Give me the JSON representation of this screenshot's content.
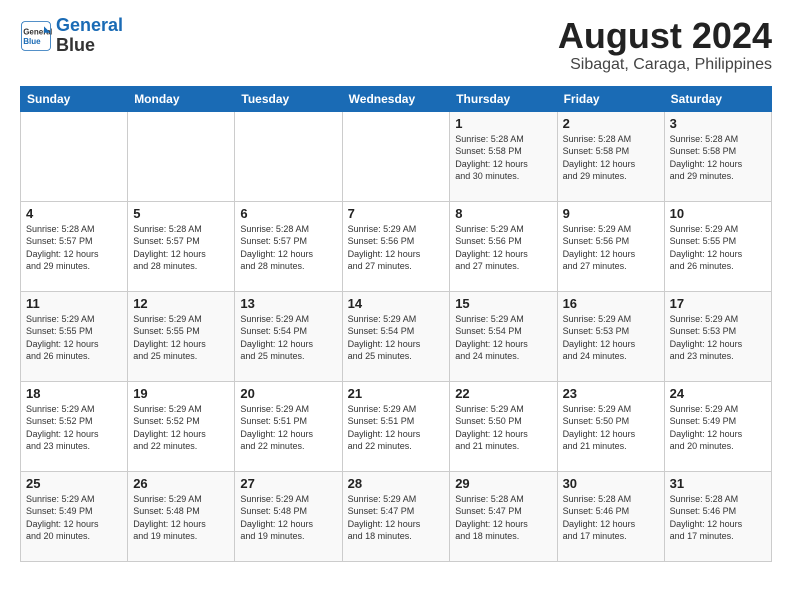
{
  "header": {
    "logo_line1": "General",
    "logo_line2": "Blue",
    "title": "August 2024",
    "subtitle": "Sibagat, Caraga, Philippines"
  },
  "columns": [
    "Sunday",
    "Monday",
    "Tuesday",
    "Wednesday",
    "Thursday",
    "Friday",
    "Saturday"
  ],
  "rows": [
    [
      {
        "num": "",
        "info": ""
      },
      {
        "num": "",
        "info": ""
      },
      {
        "num": "",
        "info": ""
      },
      {
        "num": "",
        "info": ""
      },
      {
        "num": "1",
        "info": "Sunrise: 5:28 AM\nSunset: 5:58 PM\nDaylight: 12 hours\nand 30 minutes."
      },
      {
        "num": "2",
        "info": "Sunrise: 5:28 AM\nSunset: 5:58 PM\nDaylight: 12 hours\nand 29 minutes."
      },
      {
        "num": "3",
        "info": "Sunrise: 5:28 AM\nSunset: 5:58 PM\nDaylight: 12 hours\nand 29 minutes."
      }
    ],
    [
      {
        "num": "4",
        "info": "Sunrise: 5:28 AM\nSunset: 5:57 PM\nDaylight: 12 hours\nand 29 minutes."
      },
      {
        "num": "5",
        "info": "Sunrise: 5:28 AM\nSunset: 5:57 PM\nDaylight: 12 hours\nand 28 minutes."
      },
      {
        "num": "6",
        "info": "Sunrise: 5:28 AM\nSunset: 5:57 PM\nDaylight: 12 hours\nand 28 minutes."
      },
      {
        "num": "7",
        "info": "Sunrise: 5:29 AM\nSunset: 5:56 PM\nDaylight: 12 hours\nand 27 minutes."
      },
      {
        "num": "8",
        "info": "Sunrise: 5:29 AM\nSunset: 5:56 PM\nDaylight: 12 hours\nand 27 minutes."
      },
      {
        "num": "9",
        "info": "Sunrise: 5:29 AM\nSunset: 5:56 PM\nDaylight: 12 hours\nand 27 minutes."
      },
      {
        "num": "10",
        "info": "Sunrise: 5:29 AM\nSunset: 5:55 PM\nDaylight: 12 hours\nand 26 minutes."
      }
    ],
    [
      {
        "num": "11",
        "info": "Sunrise: 5:29 AM\nSunset: 5:55 PM\nDaylight: 12 hours\nand 26 minutes."
      },
      {
        "num": "12",
        "info": "Sunrise: 5:29 AM\nSunset: 5:55 PM\nDaylight: 12 hours\nand 25 minutes."
      },
      {
        "num": "13",
        "info": "Sunrise: 5:29 AM\nSunset: 5:54 PM\nDaylight: 12 hours\nand 25 minutes."
      },
      {
        "num": "14",
        "info": "Sunrise: 5:29 AM\nSunset: 5:54 PM\nDaylight: 12 hours\nand 25 minutes."
      },
      {
        "num": "15",
        "info": "Sunrise: 5:29 AM\nSunset: 5:54 PM\nDaylight: 12 hours\nand 24 minutes."
      },
      {
        "num": "16",
        "info": "Sunrise: 5:29 AM\nSunset: 5:53 PM\nDaylight: 12 hours\nand 24 minutes."
      },
      {
        "num": "17",
        "info": "Sunrise: 5:29 AM\nSunset: 5:53 PM\nDaylight: 12 hours\nand 23 minutes."
      }
    ],
    [
      {
        "num": "18",
        "info": "Sunrise: 5:29 AM\nSunset: 5:52 PM\nDaylight: 12 hours\nand 23 minutes."
      },
      {
        "num": "19",
        "info": "Sunrise: 5:29 AM\nSunset: 5:52 PM\nDaylight: 12 hours\nand 22 minutes."
      },
      {
        "num": "20",
        "info": "Sunrise: 5:29 AM\nSunset: 5:51 PM\nDaylight: 12 hours\nand 22 minutes."
      },
      {
        "num": "21",
        "info": "Sunrise: 5:29 AM\nSunset: 5:51 PM\nDaylight: 12 hours\nand 22 minutes."
      },
      {
        "num": "22",
        "info": "Sunrise: 5:29 AM\nSunset: 5:50 PM\nDaylight: 12 hours\nand 21 minutes."
      },
      {
        "num": "23",
        "info": "Sunrise: 5:29 AM\nSunset: 5:50 PM\nDaylight: 12 hours\nand 21 minutes."
      },
      {
        "num": "24",
        "info": "Sunrise: 5:29 AM\nSunset: 5:49 PM\nDaylight: 12 hours\nand 20 minutes."
      }
    ],
    [
      {
        "num": "25",
        "info": "Sunrise: 5:29 AM\nSunset: 5:49 PM\nDaylight: 12 hours\nand 20 minutes."
      },
      {
        "num": "26",
        "info": "Sunrise: 5:29 AM\nSunset: 5:48 PM\nDaylight: 12 hours\nand 19 minutes."
      },
      {
        "num": "27",
        "info": "Sunrise: 5:29 AM\nSunset: 5:48 PM\nDaylight: 12 hours\nand 19 minutes."
      },
      {
        "num": "28",
        "info": "Sunrise: 5:29 AM\nSunset: 5:47 PM\nDaylight: 12 hours\nand 18 minutes."
      },
      {
        "num": "29",
        "info": "Sunrise: 5:28 AM\nSunset: 5:47 PM\nDaylight: 12 hours\nand 18 minutes."
      },
      {
        "num": "30",
        "info": "Sunrise: 5:28 AM\nSunset: 5:46 PM\nDaylight: 12 hours\nand 17 minutes."
      },
      {
        "num": "31",
        "info": "Sunrise: 5:28 AM\nSunset: 5:46 PM\nDaylight: 12 hours\nand 17 minutes."
      }
    ]
  ]
}
